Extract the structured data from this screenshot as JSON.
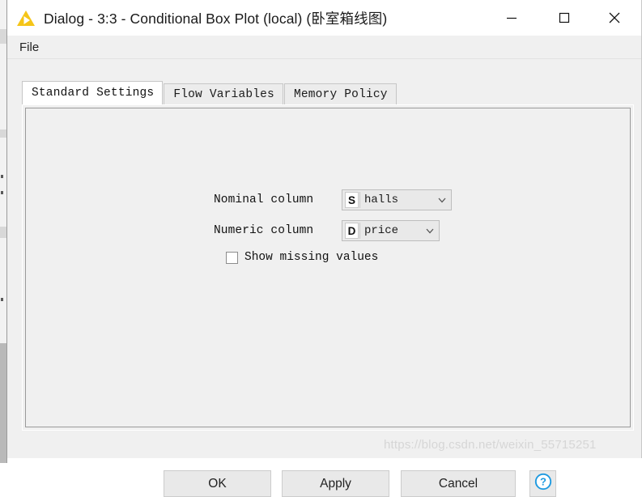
{
  "window": {
    "title": "Dialog - 3:3 - Conditional Box Plot (local) (卧室箱线图)",
    "app_icon": "knime-triangle-icon",
    "controls": {
      "minimize": "minimize-icon",
      "maximize": "maximize-icon",
      "close": "close-icon"
    }
  },
  "menu": {
    "items": [
      {
        "label": "File"
      }
    ]
  },
  "tabs": [
    {
      "label": "Standard Settings",
      "active": true
    },
    {
      "label": "Flow Variables",
      "active": false
    },
    {
      "label": "Memory Policy",
      "active": false
    }
  ],
  "form": {
    "nominal": {
      "label": "Nominal column",
      "badge": "S",
      "value": "halls",
      "arrow": "chevron-down-icon"
    },
    "numeric": {
      "label": "Numeric column",
      "badge": "D",
      "value": "price",
      "arrow": "chevron-down-icon"
    },
    "show_missing": {
      "label": "Show missing values",
      "checked": false
    }
  },
  "buttons": {
    "ok": "OK",
    "apply": "Apply",
    "cancel": "Cancel",
    "help": "?"
  },
  "watermark": "https://blog.csdn.net/weixin_55715251",
  "colors": {
    "accent_icon": "#f5c518",
    "help_blue": "#1e9ae0",
    "dialog_bg": "#f0f0f0",
    "title_bg": "#ffffff",
    "border": "#c6c6c6"
  }
}
